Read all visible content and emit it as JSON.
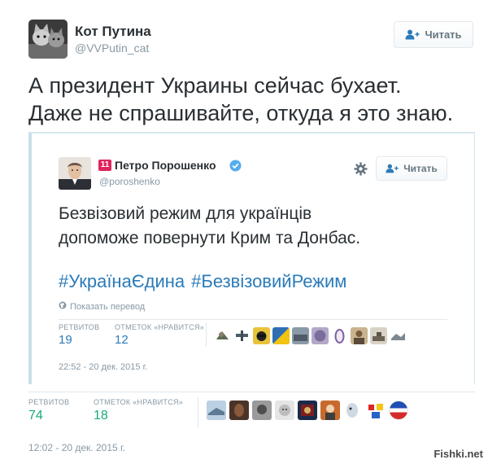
{
  "outer": {
    "author_name": "Кот Путина",
    "author_handle": "@VVPutin_cat",
    "follow_label": "Читать",
    "text_lines": [
      "А президент Украины сейчас бухает.",
      "Даже не спрашивайте, откуда я это знаю."
    ],
    "retweets_label": "РЕТВИТОВ",
    "retweets_count": "74",
    "likes_label": "ОТМЕТОК «НРАВИТСЯ»",
    "likes_count": "18",
    "timestamp": "12:02 - 20 дек. 2015 г."
  },
  "embedded": {
    "badge": "11",
    "author_name": "Петро Порошенко",
    "author_handle": "@poroshenko",
    "follow_label": "Читать",
    "text_lines": [
      "Безвізовий режим для українців",
      "допоможе повернути Крим та Донбас."
    ],
    "hashtags": [
      "#УкраїнаЄдина",
      "#БезвізовийРежим"
    ],
    "translate_label": "Показать перевод",
    "retweets_label": "РЕТВИТОВ",
    "retweets_count": "19",
    "likes_label": "ОТМЕТОК «НРАВИТСЯ»",
    "likes_count": "12",
    "timestamp": "22:52 - 20 дек. 2015 г."
  },
  "watermark": "Fishki.net",
  "icons": {
    "follow": "person-plus-icon",
    "settings": "gear-icon",
    "verified": "verified-badge-icon",
    "translate": "globe-icon"
  },
  "colors": {
    "link": "#2b7bb9",
    "muted": "#8899a6",
    "retweet_green": "#19cf86",
    "verified_blue": "#55acee",
    "badge_red": "#e0245e"
  }
}
